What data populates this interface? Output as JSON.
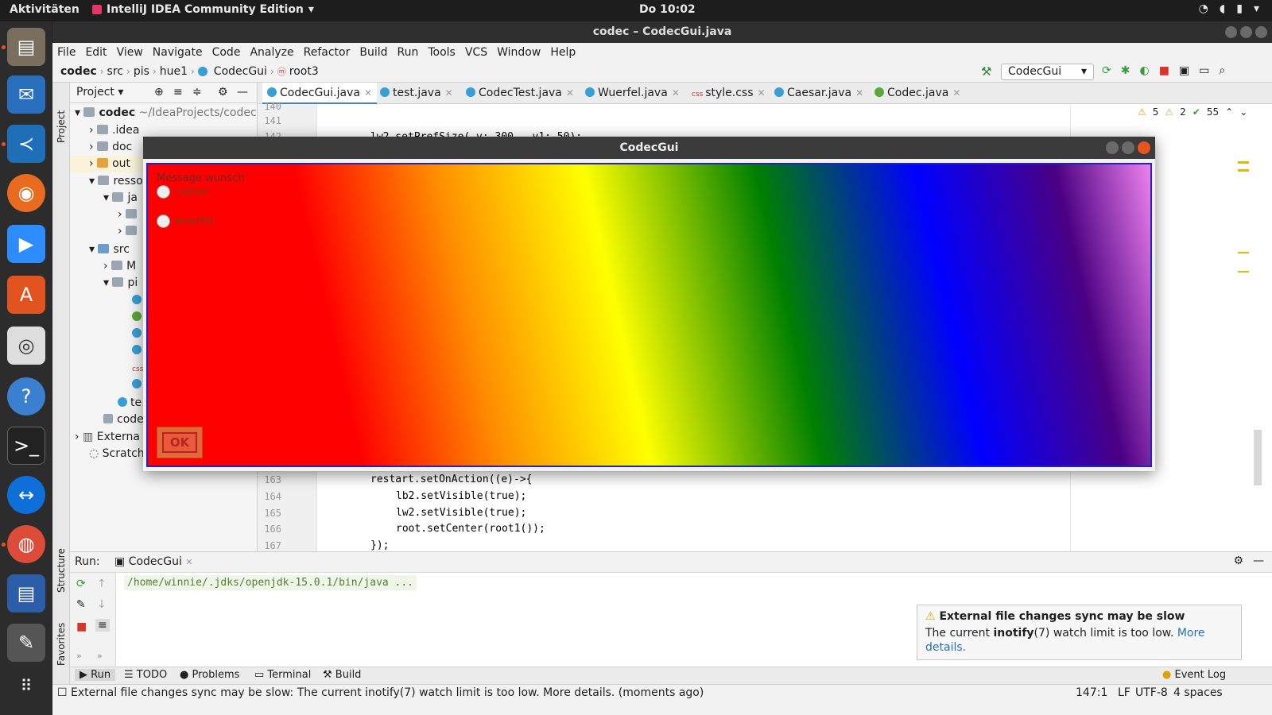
{
  "topbar": {
    "activities": "Aktivitäten",
    "app": "IntelliJ IDEA Community Edition",
    "clock": "Do 10:02"
  },
  "ide": {
    "title": "codec – CodecGui.java",
    "menu": [
      "File",
      "Edit",
      "View",
      "Navigate",
      "Code",
      "Analyze",
      "Refactor",
      "Build",
      "Run",
      "Tools",
      "VCS",
      "Window",
      "Help"
    ],
    "breadcrumbs": [
      "codec",
      "src",
      "pis",
      "hue1",
      "CodecGui",
      "root3"
    ],
    "run_config": "CodecGui",
    "project": {
      "header": "Project",
      "root": "codec",
      "root_path": "~/IdeaProjects/codec",
      "items": [
        ".idea",
        "doc",
        "out",
        "resso",
        "ja",
        "src",
        "M",
        "pi",
        "te",
        "codec",
        "Externa",
        "Scratch"
      ]
    },
    "tabs": [
      "CodecGui.java",
      "test.java",
      "CodecTest.java",
      "Wuerfel.java",
      "style.css",
      "Caesar.java",
      "Codec.java"
    ],
    "inspections": {
      "warnings": "5",
      "weak": "2",
      "ok": "55"
    },
    "code": {
      "lines_top": [
        "140",
        "141",
        "142"
      ],
      "line_142": "lw2.setPrefSize( v: 300,  v1: 50);",
      "lines": [
        {
          "n": "163",
          "text": "restart.setOnAction((e)->{"
        },
        {
          "n": "164",
          "text": "lb2.setVisible(true);"
        },
        {
          "n": "165",
          "text": "lw2.setVisible(true);"
        },
        {
          "n": "166",
          "text": "root.setCenter(root1());"
        },
        {
          "n": "167",
          "text": "});"
        }
      ]
    },
    "run": {
      "label": "Run:",
      "tab": "CodecGui",
      "command": "/home/winnie/.jdks/openjdk-15.0.1/bin/java ..."
    },
    "notification": {
      "title": "External file changes sync may be slow",
      "body_pre": "The current ",
      "body_bold": "inotify",
      "body_post": "(7) watch limit is too low. ",
      "link": "More details."
    },
    "tool_tabs": [
      "Run",
      "TODO",
      "Problems",
      "Terminal",
      "Build"
    ],
    "event_log": "Event Log",
    "side_labels": {
      "project": "Project",
      "structure": "Structure",
      "favorites": "Favorites"
    },
    "status": {
      "message": "External file changes sync may be slow: The current inotify(7) watch limit is too low. More details. (moments ago)",
      "position": "147:1",
      "line_sep": "LF",
      "encoding": "UTF-8",
      "indent": "4 spaces"
    }
  },
  "codecgui": {
    "title": "CodecGui",
    "label": "Message wunsch",
    "options": [
      "caesar",
      "wuerfel"
    ],
    "ok": "OK"
  }
}
